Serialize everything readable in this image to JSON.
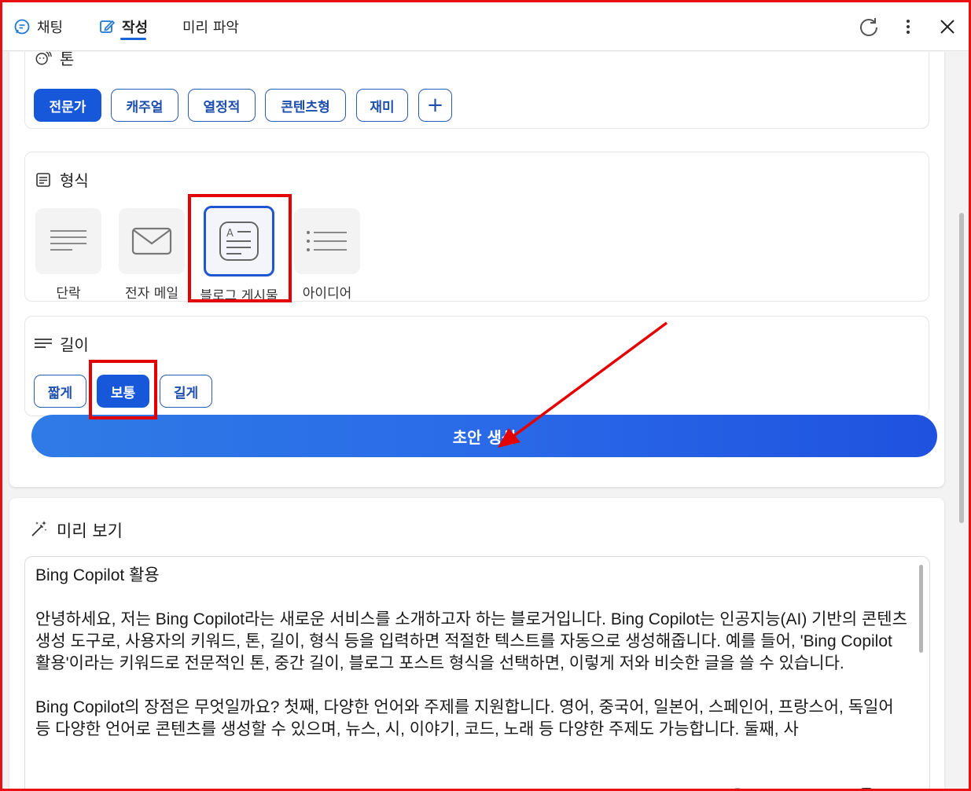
{
  "header": {
    "tabs": [
      {
        "label": "채팅",
        "icon": "chat-bubble-icon"
      },
      {
        "label": "작성",
        "icon": "edit-pencil-icon"
      },
      {
        "label": "미리 파악",
        "icon": ""
      }
    ],
    "active_tab": "작성",
    "actions": [
      "refresh-icon",
      "more-vertical-icon",
      "close-icon"
    ]
  },
  "tone": {
    "title": "톤",
    "options": [
      "전문가",
      "캐주얼",
      "열정적",
      "콘텐츠형",
      "재미"
    ],
    "selected": "전문가",
    "add_label": "+"
  },
  "format": {
    "title": "형식",
    "options": [
      "단락",
      "전자 메일",
      "블로그 게시물",
      "아이디어"
    ],
    "selected": "블로그 게시물"
  },
  "length": {
    "title": "길이",
    "options": [
      "짧게",
      "보통",
      "길게"
    ],
    "selected": "보통"
  },
  "generate_button": "초안 생성",
  "preview": {
    "title": "미리 보기",
    "paragraphs": [
      "Bing Copilot 활용",
      "안녕하세요, 저는 Bing Copilot라는 새로운 서비스를 소개하고자 하는 블로거입니다. Bing Copilot는 인공지능(AI) 기반의 콘텐츠 생성 도구로, 사용자의 키워드, 톤, 길이, 형식 등을 입력하면 적절한 텍스트를 자동으로 생성해줍니다. 예를 들어, 'Bing Copilot 활용'이라는 키워드로 전문적인 톤, 중간 길이, 블로그 포스트 형식을 선택하면, 이렇게 저와 비슷한 글을 쓸 수 있습니다.",
      "Bing Copilot의 장점은 무엇일까요? 첫째, 다양한 언어와 주제를 지원합니다. 영어, 중국어, 일본어, 스페인어, 프랑스어, 독일어 등 다양한 언어로 콘텐츠를 생성할 수 있으며, 뉴스, 시, 이야기, 코드, 노래 등 다양한 주제도 가능합니다. 둘째, 사"
    ],
    "tools": [
      "stop-icon",
      "back-arrow-icon",
      "forward-arrow-icon",
      "copy-icon",
      "regenerate-icon"
    ]
  },
  "annotation_color": "#e50000",
  "accent_color": "#1757d9"
}
